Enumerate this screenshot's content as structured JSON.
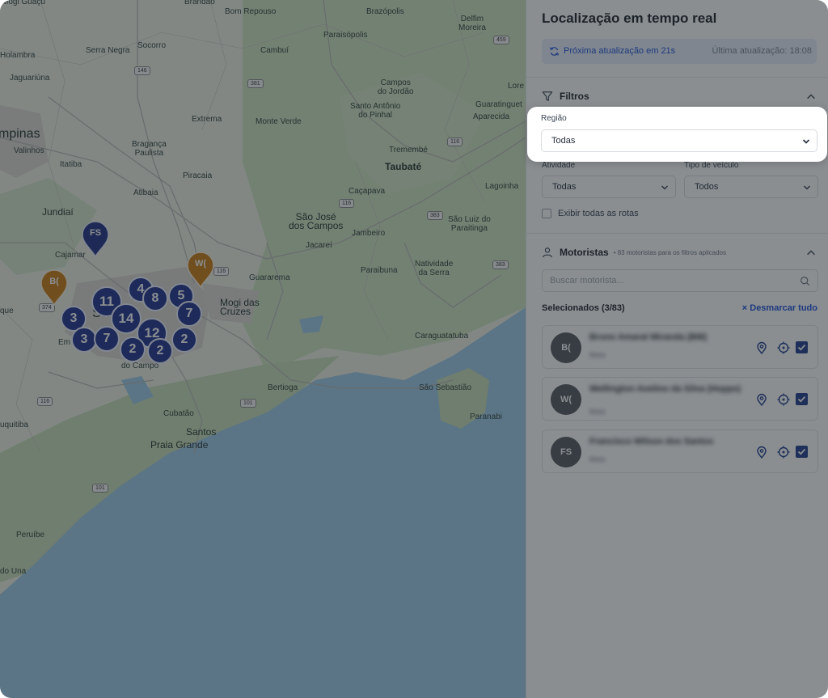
{
  "map": {
    "places": [
      {
        "text": "Mogi Guaçu",
        "size": "small"
      },
      {
        "text": "Brandão",
        "size": "small"
      },
      {
        "text": "Bom Repouso",
        "size": "small"
      },
      {
        "text": "Brazópolis",
        "size": "small"
      },
      {
        "text": "Delfim\nMoreira",
        "size": "small"
      },
      {
        "text": "Paraisópolis",
        "size": "small"
      },
      {
        "text": "Holambra",
        "size": "small"
      },
      {
        "text": "Serra Negra",
        "size": "small"
      },
      {
        "text": "Socorro",
        "size": "small"
      },
      {
        "text": "Cambuí",
        "size": "small"
      },
      {
        "text": "Jaguariúna",
        "size": "small"
      },
      {
        "text": "Campos\ndo Jordão",
        "size": "small"
      },
      {
        "text": "Santo Antônio\ndo Pinhal",
        "size": "small"
      },
      {
        "text": "Guaratinguet",
        "size": "small"
      },
      {
        "text": "Lore",
        "size": "small"
      },
      {
        "text": "Aparecida",
        "size": "small"
      },
      {
        "text": "Extrema",
        "size": "small"
      },
      {
        "text": "Monte Verde",
        "size": "small"
      },
      {
        "text": "mpinas",
        "size": "big"
      },
      {
        "text": "Valinhos",
        "size": "small"
      },
      {
        "text": "Bragança\nPaulista",
        "size": "small"
      },
      {
        "text": "Itatiba",
        "size": "small"
      },
      {
        "text": "Tremembé",
        "size": "small"
      },
      {
        "text": "Taubaté",
        "size": "mid"
      },
      {
        "text": "Piracaia",
        "size": "small"
      },
      {
        "text": "Atibaia",
        "size": "small"
      },
      {
        "text": "Caçapava",
        "size": "small"
      },
      {
        "text": "Lagoinha",
        "size": "small"
      },
      {
        "text": "Jundiaí",
        "size": "mid"
      },
      {
        "text": "São José\ndos Campos",
        "size": "mid"
      },
      {
        "text": "Jambeiro",
        "size": "small"
      },
      {
        "text": "São Luiz do\nParaitinga",
        "size": "small"
      },
      {
        "text": "Cajamar",
        "size": "small"
      },
      {
        "text": "Guararema",
        "size": "small"
      },
      {
        "text": "Jacareí",
        "size": "small"
      },
      {
        "text": "Paraibuna",
        "size": "small"
      },
      {
        "text": "Natividade\nda Serra",
        "size": "small"
      },
      {
        "text": "Mogi das\nCruzes",
        "size": "mid"
      },
      {
        "text": "que",
        "size": "small"
      },
      {
        "text": "Em",
        "size": "small"
      },
      {
        "text": "do Campo",
        "size": "small"
      },
      {
        "text": "Caraguatatuba",
        "size": "small"
      },
      {
        "text": "Bertioga",
        "size": "small"
      },
      {
        "text": "São Sebastião",
        "size": "small"
      },
      {
        "text": "uquitiba",
        "size": "small"
      },
      {
        "text": "Cubatão",
        "size": "small"
      },
      {
        "text": "Paranabi",
        "size": "small"
      },
      {
        "text": "Santos",
        "size": "mid"
      },
      {
        "text": "Praia Grande",
        "size": "mid"
      },
      {
        "text": "Peruíbe",
        "size": "small"
      },
      {
        "text": "do Una",
        "size": "small"
      },
      {
        "text": "Sa",
        "size": "big"
      }
    ],
    "shields": [
      "459",
      "146",
      "381",
      "116",
      "116",
      "383",
      "383",
      "116",
      "374",
      "116",
      "101",
      "101"
    ],
    "clusters": [
      "4",
      "5",
      "11",
      "8",
      "7",
      "3",
      "14",
      "12",
      "3",
      "7",
      "2",
      "2",
      "2"
    ],
    "pins": [
      {
        "label": "FS",
        "color": "#1f2f82"
      },
      {
        "label": "B(",
        "color": "#c97a10"
      },
      {
        "label": "W(",
        "color": "#c97a10"
      }
    ]
  },
  "panel": {
    "title": "Localização em tempo real",
    "update": {
      "next": "Próxima atualização em 21s",
      "last": "Última atualização: 18:08"
    },
    "filters": {
      "title": "Filtros",
      "region_label": "Região",
      "region_value": "Todas",
      "activity_label": "Atividade",
      "activity_value": "Todas",
      "vehicle_label": "Tipo de veículo",
      "vehicle_value": "Todos",
      "show_routes_label": "Exibir todas as rotas"
    },
    "drivers": {
      "title": "Motoristas",
      "subtitle": "• 83 motoristas para os filtros aplicados",
      "search_placeholder": "Buscar motorista...",
      "selected_label": "Selecionados (3/83)",
      "deselect_label": "× Desmarcar tudo",
      "items": [
        {
          "initials": "B(",
          "name": "Bruno Amaral Miranda (BM)",
          "sub": "Moto"
        },
        {
          "initials": "W(",
          "name": "Wellington Avelino da Silva (Hopps)",
          "sub": "Moto"
        },
        {
          "initials": "FS",
          "name": "Francisco Wilson dos Santos",
          "sub": "Moto"
        }
      ]
    }
  },
  "colors": {
    "accent": "#1d4ed8",
    "cluster": "#1c2f8c",
    "pin_orange": "#c97a10",
    "overlay": "#1e262c"
  }
}
